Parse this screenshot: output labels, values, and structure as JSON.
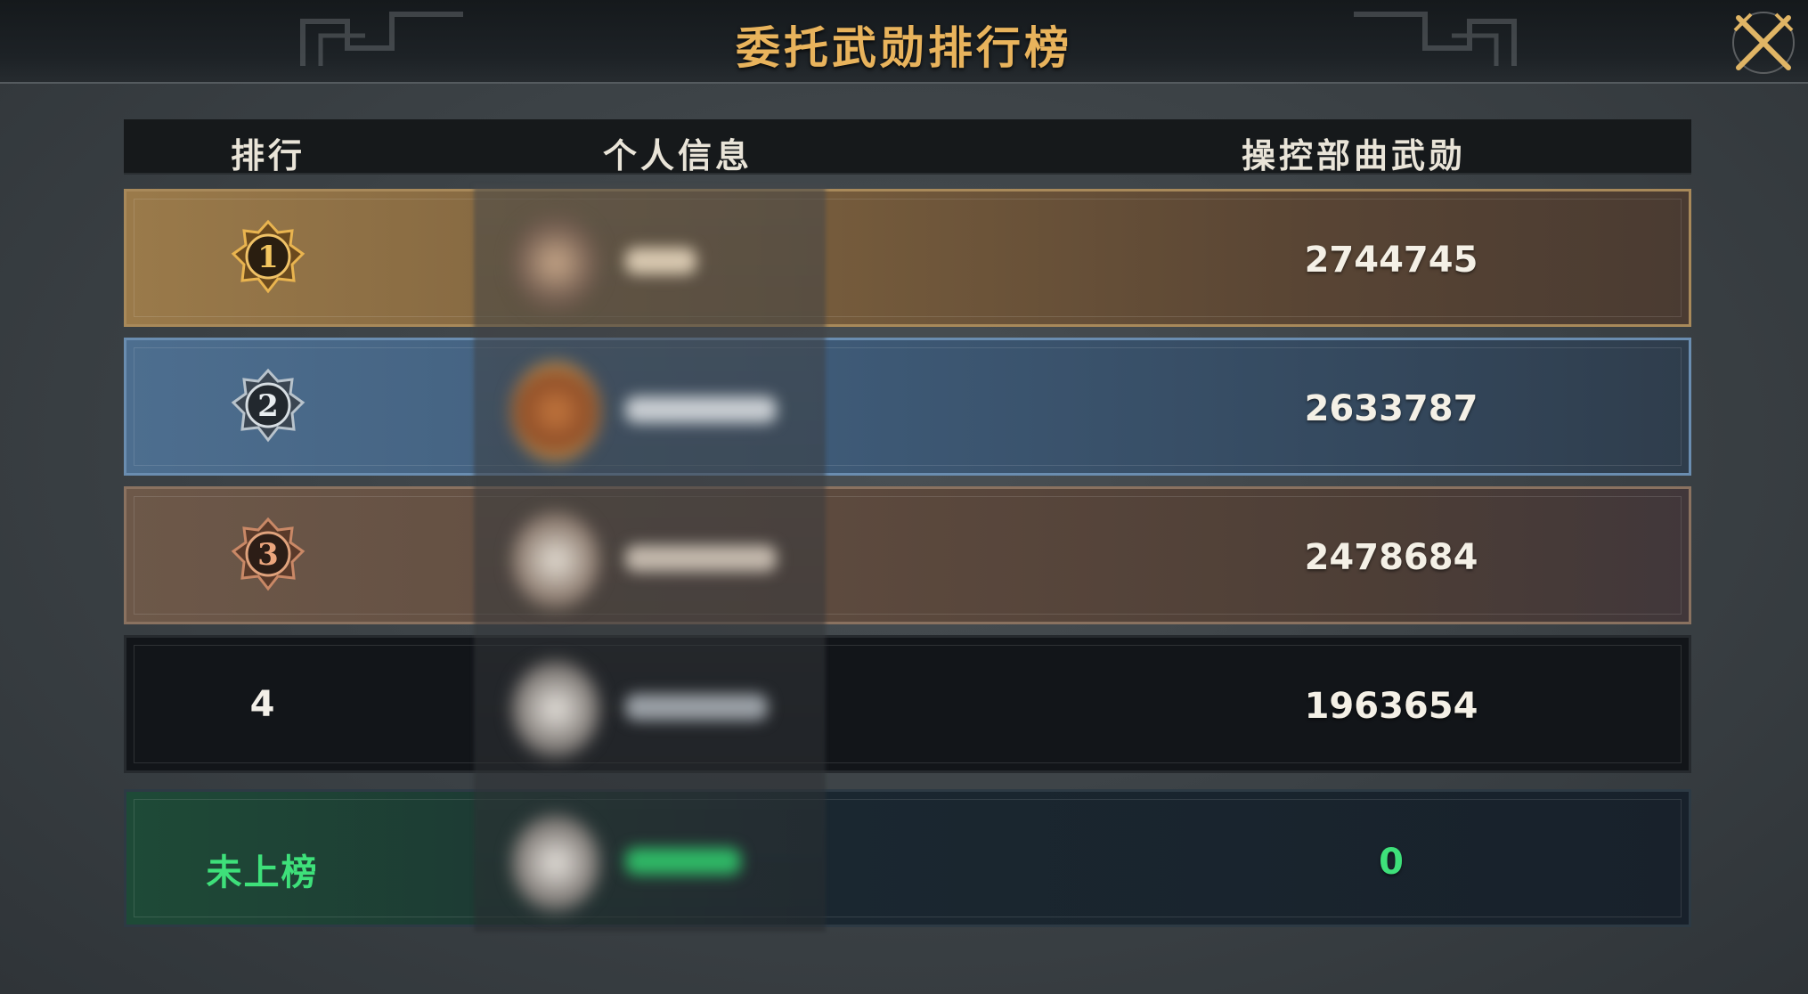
{
  "title": "委托武勋排行榜",
  "headers": {
    "rank": "排行",
    "info": "个人信息",
    "score": "操控部曲武勋"
  },
  "rows": [
    {
      "rank": "1",
      "score": "2744745"
    },
    {
      "rank": "2",
      "score": "2633787"
    },
    {
      "rank": "3",
      "score": "2478684"
    },
    {
      "rank": "4",
      "score": "1963654"
    }
  ],
  "self": {
    "rank": "未上榜",
    "score": "0"
  },
  "colors": {
    "title": "#e8b35c",
    "self_highlight": "#3ee07a"
  }
}
